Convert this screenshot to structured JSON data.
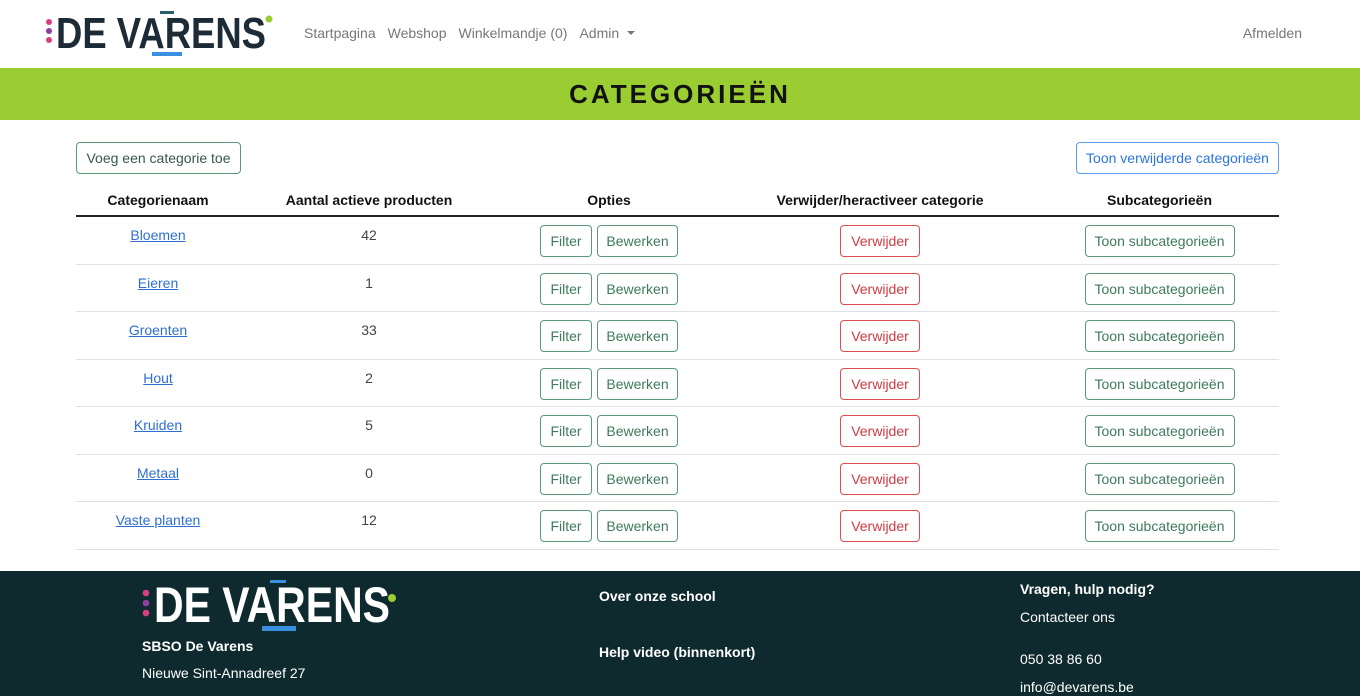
{
  "brand": {
    "logo_text": "DE VARENS",
    "logo_icon": "de-varens-logo"
  },
  "nav": {
    "links": [
      {
        "label": "Startpagina"
      },
      {
        "label": "Webshop"
      },
      {
        "label": "Winkelmandje (0)"
      },
      {
        "label": "Admin",
        "icon": "caret-down-icon"
      }
    ],
    "logout": "Afmelden"
  },
  "page": {
    "title": "CATEGORIEËN"
  },
  "toolbar": {
    "add_category": "Voeg een categorie toe",
    "show_deleted": "Toon verwijderde categorieën"
  },
  "table": {
    "headers": [
      "Categorienaam",
      "Aantal actieve producten",
      "Opties",
      "Verwijder/heractiveer categorie",
      "Subcategorieën"
    ],
    "rows": [
      {
        "name": "Bloemen",
        "active_products": 42
      },
      {
        "name": "Eieren",
        "active_products": 1
      },
      {
        "name": "Groenten",
        "active_products": 33
      },
      {
        "name": "Hout",
        "active_products": 2
      },
      {
        "name": "Kruiden",
        "active_products": 5
      },
      {
        "name": "Metaal",
        "active_products": 0
      },
      {
        "name": "Vaste planten",
        "active_products": 12
      }
    ],
    "actions": {
      "filter": "Filter",
      "edit": "Bewerken",
      "delete": "Verwijder",
      "show_subcategories": "Toon subcategorieën"
    }
  },
  "footer": {
    "logo_text": "DE VARENS",
    "school_name": "SBSO De Varens",
    "address": "Nieuwe Sint-Annadreef 27",
    "links": [
      "Over onze school",
      "Help video (binnenkort)"
    ],
    "contact_heading": "Vragen, hulp nodig?",
    "contact_link": "Contacteer ons",
    "phone": "050 38 86 60",
    "email": "info@devarens.be"
  },
  "colors": {
    "banner_green": "#9acd32",
    "footer_background": "#0f2a2e",
    "link_blue": "#2f6fd0",
    "success_outline": "#5a9a78",
    "danger_outline": "#dc4c55",
    "primary_outline": "#5b9bf0",
    "logo_blue": "#3b8fe0",
    "logo_pink": "#d9407f",
    "logo_purple": "#8c3f9e"
  }
}
